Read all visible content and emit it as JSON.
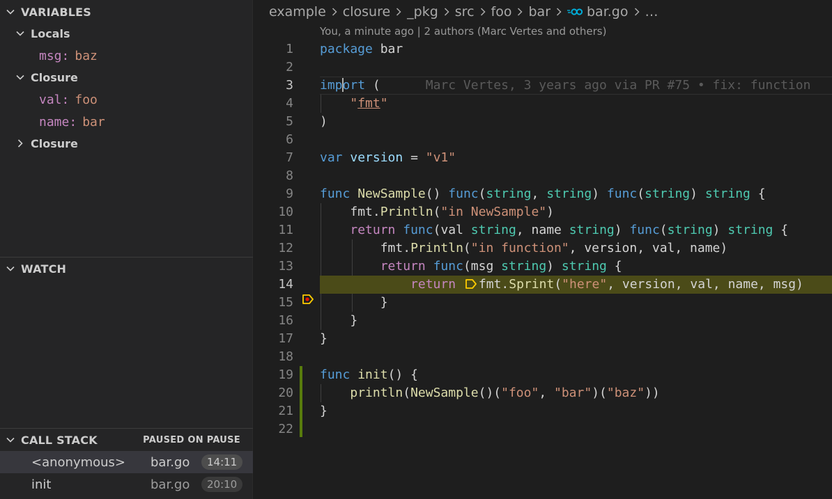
{
  "sidebar": {
    "variables": {
      "header": "VARIABLES",
      "scopes": [
        {
          "label": "Locals",
          "expanded": true,
          "vars": [
            {
              "name": "msg",
              "value": "baz"
            }
          ]
        },
        {
          "label": "Closure",
          "expanded": true,
          "vars": [
            {
              "name": "val",
              "value": "foo"
            },
            {
              "name": "name",
              "value": "bar"
            }
          ]
        },
        {
          "label": "Closure",
          "expanded": false,
          "vars": []
        }
      ]
    },
    "watch": {
      "header": "WATCH"
    },
    "call_stack": {
      "header": "CALL STACK",
      "status": "PAUSED ON PAUSE",
      "frames": [
        {
          "function": "<anonymous>",
          "file": "bar.go",
          "position": "14:11"
        },
        {
          "function": "init",
          "file": "bar.go",
          "position": "20:10"
        }
      ]
    }
  },
  "editor": {
    "breadcrumb": [
      "example",
      "closure",
      "_pkg",
      "src",
      "foo",
      "bar",
      "bar.go",
      "…"
    ],
    "blame_header": "You, a minute ago | 2 authors (Marc Vertes and others)",
    "inline_blame": "Marc Vertes, 3 years ago via PR #75 • fix: function",
    "line_numbers": [
      "1",
      "2",
      "3",
      "4",
      "5",
      "6",
      "7",
      "8",
      "9",
      "10",
      "11",
      "12",
      "13",
      "14",
      "15",
      "16",
      "17",
      "18",
      "19",
      "20",
      "21",
      "22"
    ],
    "active_line": "3",
    "paused_line": "14",
    "colors": {
      "paused_highlight": "#4b4b18",
      "breakpoint": "#ffcc00",
      "git_added": "#587c0c"
    }
  }
}
